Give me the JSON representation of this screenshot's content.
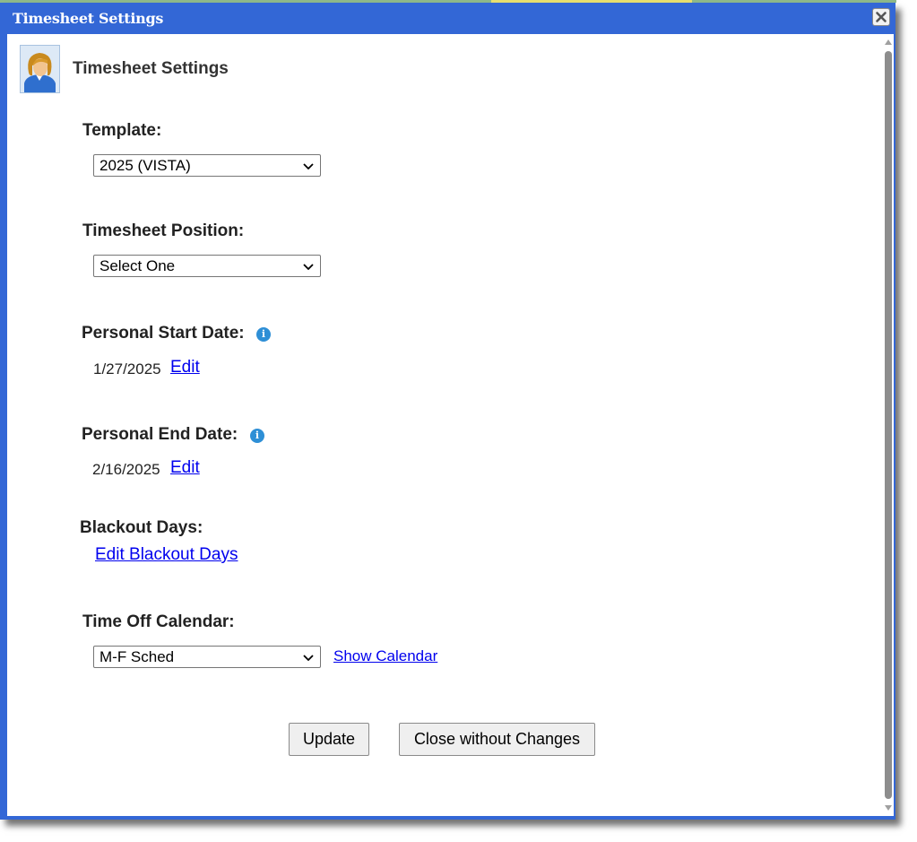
{
  "window": {
    "title": "Timesheet Settings",
    "close_icon": "close-icon"
  },
  "header": {
    "title": "Timesheet Settings",
    "avatar_icon": "user-avatar-icon"
  },
  "template": {
    "label": "Template:",
    "selected": "2025 (VISTA)"
  },
  "position": {
    "label": "Timesheet Position:",
    "selected": "Select One"
  },
  "start_date": {
    "label": "Personal Start Date:",
    "info_icon": "info-icon",
    "value": "1/27/2025",
    "edit_label": "Edit"
  },
  "end_date": {
    "label": "Personal End Date:",
    "info_icon": "info-icon",
    "value": "2/16/2025",
    "edit_label": "Edit"
  },
  "blackout": {
    "label": "Blackout Days:",
    "link": "Edit Blackout Days"
  },
  "calendar": {
    "label": "Time Off Calendar:",
    "selected": "M-F Sched",
    "show_link": "Show Calendar"
  },
  "actions": {
    "update_label": "Update",
    "close_label": "Close without Changes"
  },
  "colors": {
    "title_bar": "#3367d6",
    "link": "#0000ee",
    "info_icon": "#2e8fd6"
  }
}
